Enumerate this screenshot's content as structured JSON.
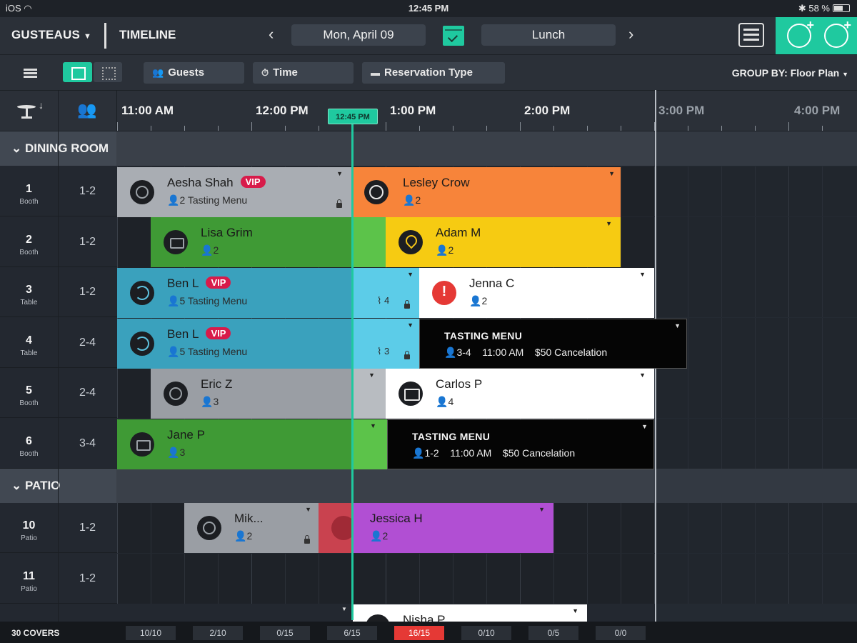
{
  "status": {
    "carrier": "iOS",
    "time": "12:45 PM",
    "battery": "58 %"
  },
  "nav": {
    "brand": "GUSTEAUS",
    "view": "TIMELINE",
    "date": "Mon, April 09",
    "service": "Lunch"
  },
  "toolbar": {
    "guests": "Guests",
    "time": "Time",
    "reservation_type": "Reservation Type",
    "group_by": "GROUP BY: Floor Plan"
  },
  "times": [
    "11:00 AM",
    "12:00 PM",
    "1:00 PM",
    "2:00 PM",
    "3:00 PM",
    "4:00 PM"
  ],
  "now_label": "12:45 PM",
  "sections": {
    "dining": "DINING ROOM",
    "patio": "PATIO"
  },
  "tables": [
    {
      "num": "1",
      "type": "Booth",
      "cap": "1-2"
    },
    {
      "num": "2",
      "type": "Booth",
      "cap": "1-2"
    },
    {
      "num": "3",
      "type": "Table",
      "cap": "1-2"
    },
    {
      "num": "4",
      "type": "Table",
      "cap": "2-4"
    },
    {
      "num": "5",
      "type": "Booth",
      "cap": "2-4"
    },
    {
      "num": "6",
      "type": "Booth",
      "cap": "3-4"
    },
    {
      "num": "10",
      "type": "Patio",
      "cap": "1-2"
    },
    {
      "num": "11",
      "type": "Patio",
      "cap": "1-2"
    }
  ],
  "reservations": {
    "aesha": {
      "name": "Aesha Shah",
      "badge": "VIP",
      "guests": "2",
      "note": "Tasting Menu"
    },
    "lesley": {
      "name": "Lesley Crow",
      "guests": "2"
    },
    "lisa": {
      "name": "Lisa Grim",
      "guests": "2"
    },
    "adam": {
      "name": "Adam M",
      "guests": "2"
    },
    "ben3": {
      "name": "Ben L",
      "badge": "VIP",
      "guests": "5",
      "note": "Tasting Menu",
      "course": "4"
    },
    "jenna": {
      "name": "Jenna C",
      "guests": "2"
    },
    "ben4": {
      "name": "Ben L",
      "badge": "VIP",
      "guests": "5",
      "note": "Tasting Menu",
      "course": "3"
    },
    "tm4": {
      "title": "TASTING MENU",
      "guests": "3-4",
      "time": "11:00 AM",
      "fee": "$50 Cancelation"
    },
    "eric": {
      "name": "Eric Z",
      "guests": "3"
    },
    "carlos": {
      "name": "Carlos P",
      "guests": "4"
    },
    "jane": {
      "name": "Jane P",
      "guests": "3"
    },
    "tm6": {
      "title": "TASTING MENU",
      "guests": "1-2",
      "time": "11:00 AM",
      "fee": "$50 Cancelation"
    },
    "mike": {
      "name": "Mik...",
      "guests": "2"
    },
    "jessica": {
      "name": "Jessica H",
      "guests": "2"
    },
    "nisha": {
      "name": "Nisha P"
    }
  },
  "footer": {
    "covers": "30 COVERS",
    "counts": [
      "10/10",
      "2/10",
      "0/15",
      "6/15",
      "16/15",
      "0/10",
      "0/5",
      "0/0"
    ]
  },
  "colors": {
    "accent": "#1fc99f",
    "vip": "#d81b4a",
    "orange": "#f7843a",
    "green": "#3f9a35",
    "yellow": "#f6cb12",
    "blue": "#3aa1bd",
    "purple": "#b14fd3",
    "alert": "#e53935"
  }
}
